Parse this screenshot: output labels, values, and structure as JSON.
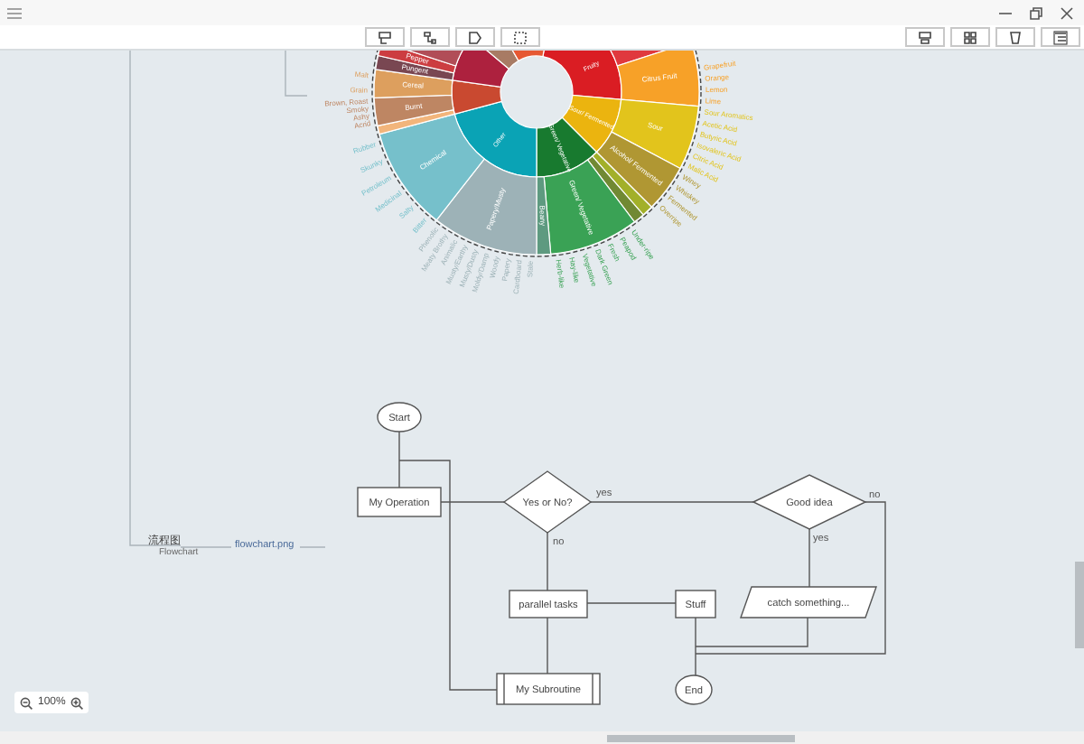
{
  "mindmap": {
    "branch": {
      "title": "流程图",
      "subtitle": "Flowchart",
      "attachment": "flowchart.png"
    }
  },
  "wheel": {
    "inner": [
      {
        "label": "Fruity",
        "color": "#da1d23",
        "children": [
          {
            "color": "#e0393e"
          },
          {
            "label": "Citrus Fruit",
            "color": "#f7a128",
            "children": [
              "Grapefruit",
              "Orange",
              "Lemon",
              "Lime"
            ]
          }
        ]
      },
      {
        "label": "Sour/ Fermented",
        "color": "#ebb40f",
        "children": [
          {
            "label": "Sour",
            "color": "#e2c41c",
            "children": [
              "Sour Aromatics",
              "Acetic Acid",
              "Butyric Acid",
              "Isovaleric Acid",
              "Citric Acid",
              "Malic Acid"
            ]
          },
          {
            "label": "Alcohol/ Fermented",
            "color": "#b09733",
            "children": [
              "Winey",
              "Whiskey",
              "Fermented",
              "Overripe"
            ]
          }
        ]
      },
      {
        "label": "Green/ Vegetative",
        "color": "#187a2f",
        "children": [
          {
            "color": "#a2b029"
          },
          {
            "color": "#718933"
          },
          {
            "label": "Green/ Vegetative",
            "color": "#3aa255",
            "children": [
              "Under-ripe",
              "Peapod",
              "Fresh",
              "Dark Green",
              "Vegetative",
              "Hay-like",
              "Herb-like"
            ]
          },
          {
            "label": "Beany",
            "color": "#5e9a80"
          }
        ]
      },
      {
        "label": "Other",
        "color": "#0aa3b5",
        "children": [
          {
            "label": "Papery/Musty",
            "color": "#9db2b7",
            "children": [
              "Stale",
              "Cardboard",
              "Papery",
              "Woody",
              "Moldy/Damp",
              "Musty/Dusty",
              "Musty/Earthy",
              "Animalic",
              "Meaty Brothy",
              "Phenolic"
            ]
          },
          {
            "label": "Chemical",
            "color": "#76c0cb",
            "children": [
              "Bitter",
              "Salty",
              "Medicinal",
              "Petroleum",
              "Skunky",
              "Rubber"
            ]
          }
        ]
      },
      {
        "color": "#c94930",
        "children": [
          {
            "color": "#f2b57b"
          },
          {
            "label": "Burnt",
            "color": "#be8663",
            "children": [
              "Acrid",
              "Ashy",
              "Smoky",
              "Brown, Roast"
            ]
          },
          {
            "label": "Cereal",
            "color": "#dd9f5e",
            "children": [
              "Grain",
              "Malt"
            ]
          }
        ]
      },
      {
        "color": "#ad213e",
        "children": [
          {
            "label": "Pungent",
            "color": "#794752"
          },
          {
            "label": "Pepper",
            "color": "#cc3d41"
          },
          {
            "color": "#b14d57"
          }
        ]
      },
      {
        "color": "#a87b64"
      },
      {
        "color": "#e65832"
      }
    ]
  },
  "flowchart": {
    "nodes": [
      {
        "kind": "terminal",
        "text": "Start"
      },
      {
        "kind": "process",
        "text": "My Operation"
      },
      {
        "kind": "decision",
        "text": "Yes or No?"
      },
      {
        "kind": "decision",
        "text": "Good idea"
      },
      {
        "kind": "process",
        "text": "parallel tasks"
      },
      {
        "kind": "process",
        "text": "Stuff"
      },
      {
        "kind": "io",
        "text": "catch something..."
      },
      {
        "kind": "subroutine",
        "text": "My Subroutine"
      },
      {
        "kind": "terminal",
        "text": "End"
      }
    ],
    "edge_labels": [
      "yes",
      "no",
      "no",
      "yes"
    ]
  },
  "zoom": {
    "value": "100%"
  }
}
